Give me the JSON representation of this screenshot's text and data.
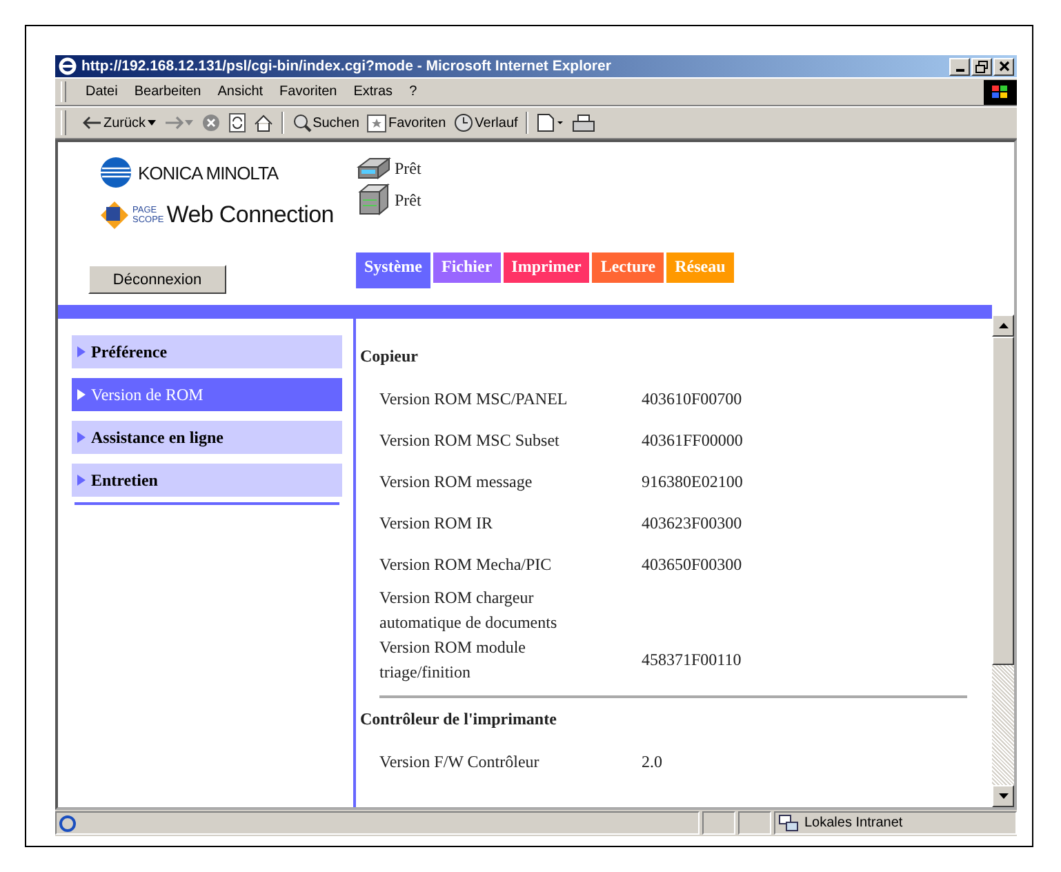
{
  "window": {
    "title": "http://192.168.12.131/psl/cgi-bin/index.cgi?mode - Microsoft Internet Explorer"
  },
  "menu": [
    "Datei",
    "Bearbeiten",
    "Ansicht",
    "Favoriten",
    "Extras",
    "?"
  ],
  "toolbar": [
    {
      "kind": "back",
      "label": "Zurück"
    },
    {
      "kind": "forward"
    },
    {
      "kind": "stop"
    },
    {
      "kind": "refresh"
    },
    {
      "kind": "home"
    },
    {
      "kind": "search",
      "label": "Suchen"
    },
    {
      "kind": "favorites",
      "label": "Favoriten"
    },
    {
      "kind": "history",
      "label": "Verlauf"
    },
    {
      "kind": "edit"
    },
    {
      "kind": "print"
    }
  ],
  "header": {
    "brand": "KONICA MINOLTA",
    "product_small_top": "PAGE",
    "product_small_bottom": "SCOPE",
    "product": "Web Connection",
    "devices": [
      {
        "kind": "copier",
        "status": "Prêt"
      },
      {
        "kind": "printer",
        "status": "Prêt"
      }
    ],
    "logout_button": "Déconnexion"
  },
  "tabs": [
    {
      "label": "Système",
      "color": "#6666ff",
      "selected": true
    },
    {
      "label": "Fichier",
      "color": "#9966ff",
      "selected": false
    },
    {
      "label": "Imprimer",
      "color": "#ff3366",
      "selected": false
    },
    {
      "label": "Lecture",
      "color": "#ff6633",
      "selected": false
    },
    {
      "label": "Réseau",
      "color": "#ff9900",
      "selected": false
    }
  ],
  "sidebar": {
    "items": [
      {
        "label": "Préférence",
        "selected": false
      },
      {
        "label": "Version de ROM",
        "selected": true
      },
      {
        "label": "Assistance en ligne",
        "selected": false
      },
      {
        "label": "Entretien",
        "selected": false
      }
    ]
  },
  "sections": [
    {
      "title": "Copieur",
      "rows": [
        {
          "label": "Version ROM MSC/PANEL",
          "value": "403610F00700"
        },
        {
          "label": "Version ROM MSC Subset",
          "value": "40361FF00000"
        },
        {
          "label": "Version ROM message",
          "value": "916380E02100"
        },
        {
          "label": "Version ROM IR",
          "value": "403623F00300"
        },
        {
          "label": "Version ROM Mecha/PIC",
          "value": "403650F00300"
        },
        {
          "label": "Version ROM chargeur automatique de documents"
        },
        {
          "label": "Version ROM module triage/finition",
          "value": "458371F00110"
        }
      ]
    },
    {
      "title": "Contrôleur de l'imprimante",
      "rows": [
        {
          "label": "Version F/W Contrôleur",
          "value": "2.0"
        }
      ]
    }
  ],
  "status_bar": {
    "zone": "Lokales Intranet"
  }
}
